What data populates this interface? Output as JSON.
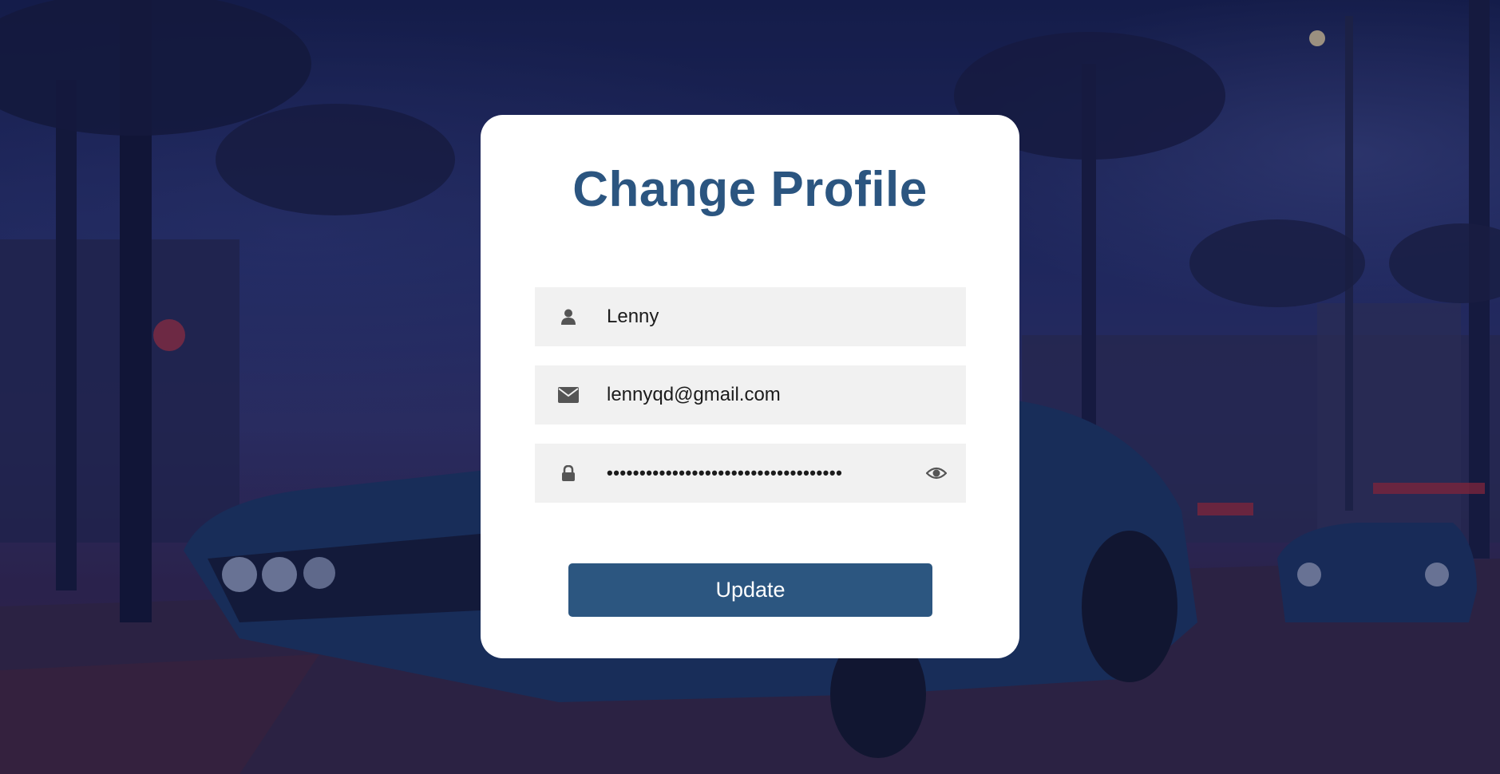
{
  "page": {
    "title": "Change Profile"
  },
  "form": {
    "username": {
      "value": "Lenny",
      "icon": "user-icon"
    },
    "email": {
      "value": "lennyqd@gmail.com",
      "icon": "envelope-icon"
    },
    "password": {
      "value": "••••••••••••••••••••••••••••••••••••",
      "icon": "lock-icon",
      "toggle_icon": "eye-icon"
    },
    "submit_label": "Update"
  },
  "colors": {
    "accent": "#2c5680",
    "title": "#2b5580",
    "field_bg": "#f1f1f1",
    "card_bg": "#ffffff"
  }
}
